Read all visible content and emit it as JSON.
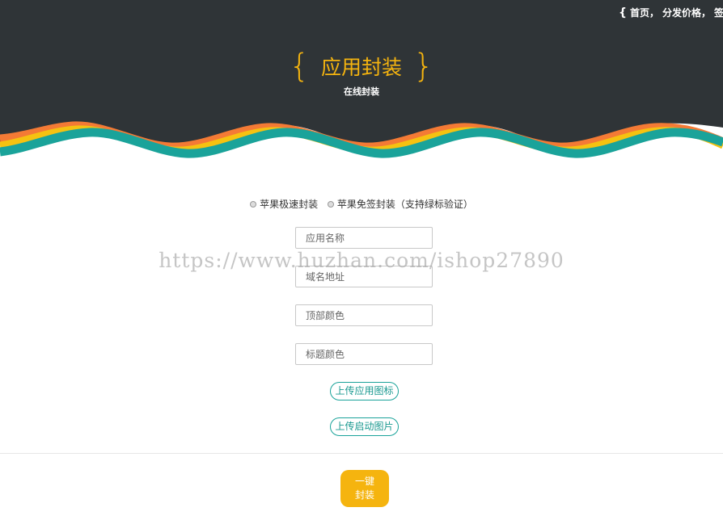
{
  "header": {
    "nav": {
      "brace": "{",
      "items": [
        "首页",
        "分发价格",
        "签"
      ],
      "separators": [
        "，",
        "，"
      ]
    },
    "brace_left": "{",
    "brace_right": "}",
    "title": "应用封装",
    "subtitle": "在线封装"
  },
  "options": [
    {
      "label": "苹果极速封装"
    },
    {
      "label": "苹果免签封装（支持绿标验证）"
    }
  ],
  "form": {
    "app_name_placeholder": "应用名称",
    "domain_placeholder": "域名地址",
    "top_color_placeholder": "顶部颜色",
    "title_color_placeholder": "标题颜色",
    "upload_icon_label": "上传应用图标",
    "upload_splash_label": "上传启动图片",
    "submit_line1": "一键",
    "submit_line2": "封装"
  },
  "watermark": "https://www.huzhan.com/ishop27890",
  "colors": {
    "header_bg": "#2f3437",
    "accent_yellow": "#f5b40f",
    "accent_teal": "#1aa39a",
    "wave_orange": "#f47a35"
  }
}
